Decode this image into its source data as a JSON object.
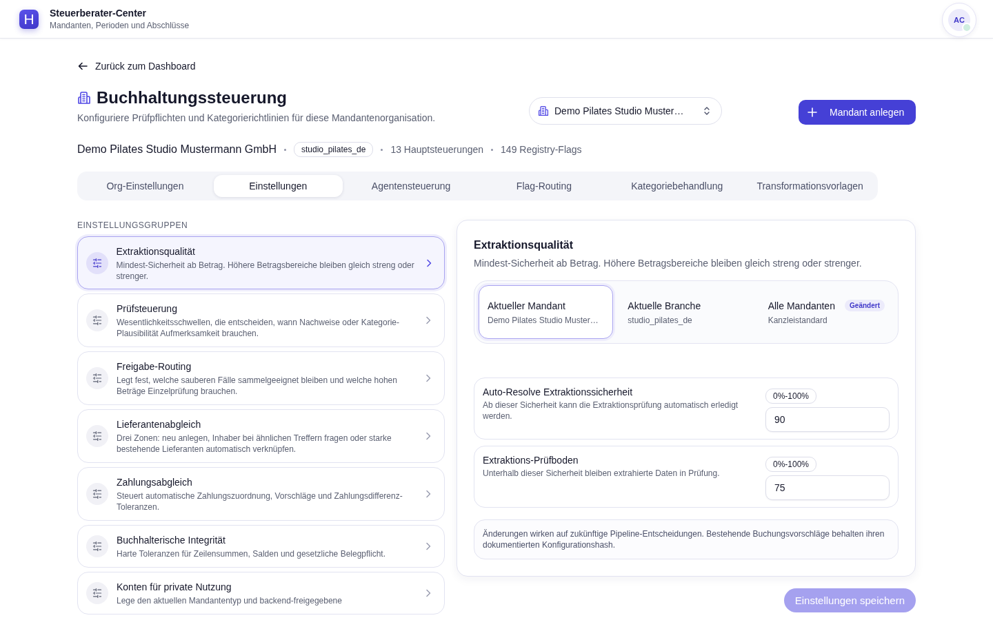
{
  "header": {
    "logo_letter": "H",
    "app_title": "Steuerberater-Center",
    "app_subtitle": "Mandanten, Perioden und Abschlüsse",
    "avatar_initials": "AC",
    "avatar_online": true
  },
  "back_link": "Zurück zum Dashboard",
  "page": {
    "title": "Buchhaltungssteuerung",
    "subtitle": "Konfiguriere Prüfpflichten und Kategorierichtlinien für diese Mandantenorganisation."
  },
  "org_select": {
    "value": "Demo Pilates Studio Muster…"
  },
  "create_button": {
    "label": "Mandant anlegen"
  },
  "org_meta": {
    "name": "Demo Pilates Studio Mustermann GmbH",
    "slug": "studio_pilates_de",
    "stats": [
      "13 Hauptsteuerungen",
      "149 Registry-Flags"
    ]
  },
  "tabs": [
    {
      "label": "Org-Einstellungen",
      "selected": false
    },
    {
      "label": "Einstellungen",
      "selected": true
    },
    {
      "label": "Agentensteuerung",
      "selected": false
    },
    {
      "label": "Flag-Routing",
      "selected": false
    },
    {
      "label": "Kategoriebehandlung",
      "selected": false
    },
    {
      "label": "Transformationsvorlagen",
      "selected": false
    }
  ],
  "groups": {
    "heading": "EINSTELLUNGSGRUPPEN",
    "items": [
      {
        "title": "Extraktionsqualität",
        "description": "Mindest-Sicherheit ab Betrag. Höhere Betragsbereiche bleiben gleich streng oder strenger.",
        "selected": true
      },
      {
        "title": "Prüfsteuerung",
        "description": "Wesentlichkeitsschwellen, die entscheiden, wann Nachweise oder Kategorie-Plausibilität Aufmerksamkeit brauchen.",
        "selected": false
      },
      {
        "title": "Freigabe-Routing",
        "description": "Legt fest, welche sauberen Fälle sammelgeeignet bleiben und welche hohen Beträge Einzelprüfung brauchen.",
        "selected": false
      },
      {
        "title": "Lieferantenabgleich",
        "description": "Drei Zonen: neu anlegen, Inhaber bei ähnlichen Treffern fragen oder starke bestehende Lieferanten automatisch verknüpfen.",
        "selected": false
      },
      {
        "title": "Zahlungsabgleich",
        "description": "Steuert automatische Zahlungszuordnung, Vorschläge und Zahlungsdifferenz-Toleranzen.",
        "selected": false
      },
      {
        "title": "Buchhalterische Integrität",
        "description": "Harte Toleranzen für Zeilensummen, Salden und gesetzliche Belegpflicht.",
        "selected": false
      },
      {
        "title": "Konten für private Nutzung",
        "description": "Lege den aktuellen Mandantentyp und backend-freigegebene",
        "selected": false
      }
    ]
  },
  "detail": {
    "title": "Extraktionsqualität",
    "description": "Mindest-Sicherheit ab Betrag. Höhere Betragsbereiche bleiben gleich streng oder strenger.",
    "scopes": [
      {
        "title": "Aktueller Mandant",
        "subtitle": "Demo Pilates Studio Muster…",
        "selected": true
      },
      {
        "title": "Aktuelle Branche",
        "subtitle": "studio_pilates_de",
        "selected": false
      },
      {
        "title": "Alle Mandanten",
        "subtitle": "Kanzleistandard",
        "selected": false,
        "badge": "Geändert"
      }
    ],
    "fields": [
      {
        "label": "Auto-Resolve Extraktionssicherheit",
        "description": "Ab dieser Sicherheit kann die Extraktionsprüfung automatisch erledigt werden.",
        "range": "0%-100%",
        "value": "90"
      },
      {
        "label": "Extraktions-Prüfboden",
        "description": "Unterhalb dieser Sicherheit bleiben extrahierte Daten in Prüfung.",
        "range": "0%-100%",
        "value": "75"
      }
    ],
    "note": "Änderungen wirken auf zukünftige Pipeline-Entscheidungen. Bestehende Buchungsvorschläge behalten ihren dokumentierten Konfigurationshash."
  },
  "save_button": {
    "label": "Einstellungen speichern",
    "disabled": true
  }
}
